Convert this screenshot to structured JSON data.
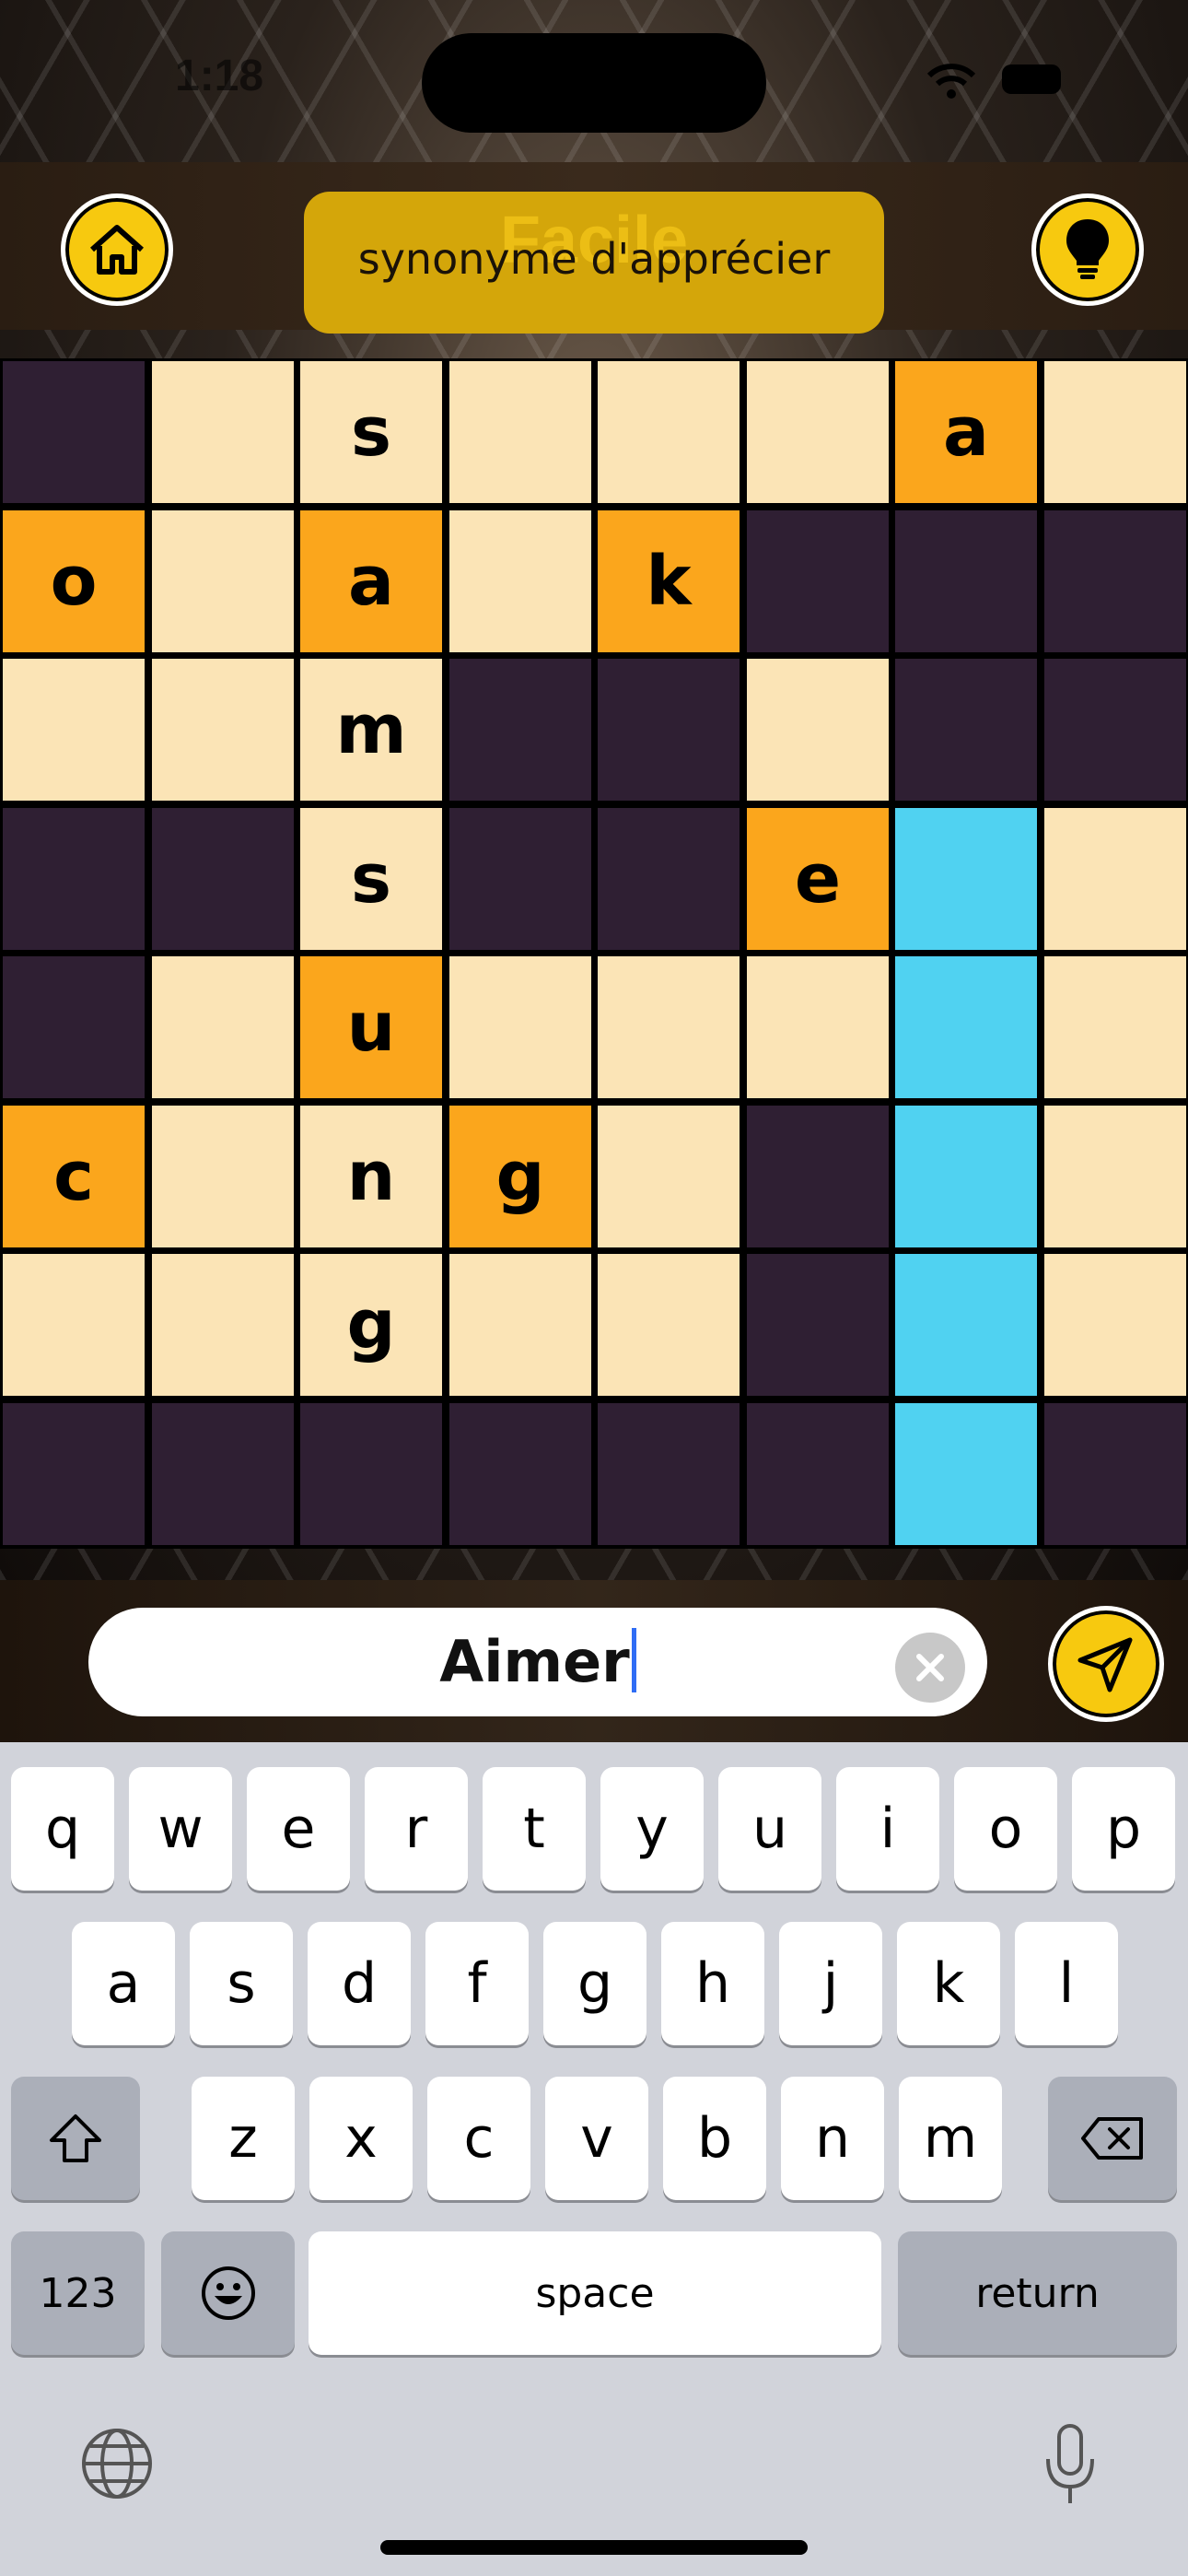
{
  "status_bar": {
    "time": "1:18"
  },
  "header": {
    "level": "Facile",
    "clue": "synonyme d'apprécier",
    "home_icon": "home-icon",
    "hint_icon": "lightbulb-icon"
  },
  "grid": {
    "rows": [
      [
        [
          "dark",
          ""
        ],
        [
          "cream",
          ""
        ],
        [
          "cream",
          "s"
        ],
        [
          "cream",
          ""
        ],
        [
          "cream",
          ""
        ],
        [
          "cream",
          ""
        ],
        [
          "orange",
          "a"
        ],
        [
          "cream",
          ""
        ]
      ],
      [
        [
          "orange",
          "o"
        ],
        [
          "cream",
          ""
        ],
        [
          "orange",
          "a"
        ],
        [
          "cream",
          ""
        ],
        [
          "orange",
          "k"
        ],
        [
          "dark",
          ""
        ],
        [
          "dark",
          ""
        ],
        [
          "dark",
          ""
        ]
      ],
      [
        [
          "cream",
          ""
        ],
        [
          "cream",
          ""
        ],
        [
          "cream",
          "m"
        ],
        [
          "dark",
          ""
        ],
        [
          "dark",
          ""
        ],
        [
          "cream",
          ""
        ],
        [
          "dark",
          ""
        ],
        [
          "dark",
          ""
        ]
      ],
      [
        [
          "dark",
          ""
        ],
        [
          "dark",
          ""
        ],
        [
          "cream",
          "s"
        ],
        [
          "dark",
          ""
        ],
        [
          "dark",
          ""
        ],
        [
          "orange",
          "e"
        ],
        [
          "blue",
          ""
        ],
        [
          "cream",
          ""
        ]
      ],
      [
        [
          "dark",
          ""
        ],
        [
          "cream",
          ""
        ],
        [
          "orange",
          "u"
        ],
        [
          "cream",
          ""
        ],
        [
          "cream",
          ""
        ],
        [
          "cream",
          ""
        ],
        [
          "blue",
          ""
        ],
        [
          "cream",
          ""
        ]
      ],
      [
        [
          "orange",
          "c"
        ],
        [
          "cream",
          ""
        ],
        [
          "cream",
          "n"
        ],
        [
          "orange",
          "g"
        ],
        [
          "cream",
          ""
        ],
        [
          "dark",
          ""
        ],
        [
          "blue",
          ""
        ],
        [
          "cream",
          ""
        ]
      ],
      [
        [
          "cream",
          ""
        ],
        [
          "cream",
          ""
        ],
        [
          "cream",
          "g"
        ],
        [
          "cream",
          ""
        ],
        [
          "cream",
          ""
        ],
        [
          "dark",
          ""
        ],
        [
          "blue",
          ""
        ],
        [
          "cream",
          ""
        ]
      ],
      [
        [
          "dark",
          ""
        ],
        [
          "dark",
          ""
        ],
        [
          "dark",
          ""
        ],
        [
          "dark",
          ""
        ],
        [
          "dark",
          ""
        ],
        [
          "dark",
          ""
        ],
        [
          "blue",
          ""
        ],
        [
          "dark",
          ""
        ]
      ]
    ]
  },
  "answer": {
    "value": "Aimer"
  },
  "keyboard": {
    "row1": [
      "q",
      "w",
      "e",
      "r",
      "t",
      "y",
      "u",
      "i",
      "o",
      "p"
    ],
    "row2": [
      "a",
      "s",
      "d",
      "f",
      "g",
      "h",
      "j",
      "k",
      "l"
    ],
    "row3": [
      "z",
      "x",
      "c",
      "v",
      "b",
      "n",
      "m"
    ],
    "numbers_label": "123",
    "space_label": "space",
    "return_label": "return"
  },
  "colors": {
    "dark": "#2f1f33",
    "cream": "#fbe4b6",
    "orange": "#fba61c",
    "blue": "#50d2f1",
    "accent": "#f7c90f"
  }
}
